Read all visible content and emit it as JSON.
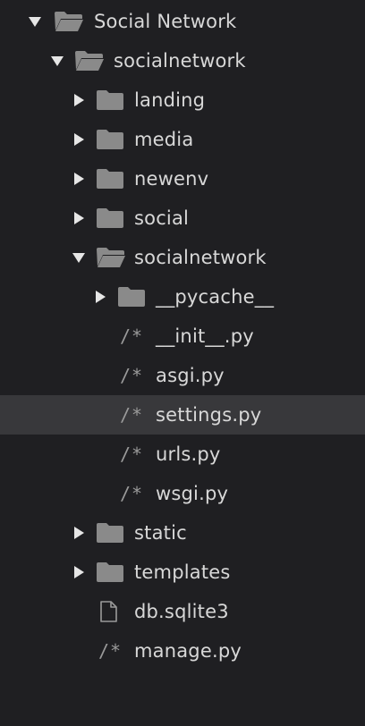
{
  "tree": {
    "root": {
      "label": "Social Network",
      "icon": "folder-open-icon"
    },
    "project": {
      "label": "socialnetwork",
      "icon": "folder-open-icon"
    },
    "children": [
      {
        "label": "landing",
        "icon": "folder-icon"
      },
      {
        "label": "media",
        "icon": "folder-icon"
      },
      {
        "label": "newenv",
        "icon": "folder-icon"
      },
      {
        "label": "social",
        "icon": "folder-icon"
      }
    ],
    "app": {
      "label": "socialnetwork",
      "icon": "folder-open-icon"
    },
    "app_children": [
      {
        "label": "__pycache__",
        "icon": "folder-icon"
      },
      {
        "label": "__init__.py",
        "icon": "python-file-icon",
        "glyph": "/*"
      },
      {
        "label": "asgi.py",
        "icon": "python-file-icon",
        "glyph": "/*"
      },
      {
        "label": "settings.py",
        "icon": "python-file-icon",
        "glyph": "/*",
        "selected": true
      },
      {
        "label": "urls.py",
        "icon": "python-file-icon",
        "glyph": "/*"
      },
      {
        "label": "wsgi.py",
        "icon": "python-file-icon",
        "glyph": "/*"
      }
    ],
    "tail": [
      {
        "label": "static",
        "icon": "folder-icon"
      },
      {
        "label": "templates",
        "icon": "folder-icon"
      },
      {
        "label": "db.sqlite3",
        "icon": "file-icon"
      },
      {
        "label": "manage.py",
        "icon": "python-file-icon",
        "glyph": "/*"
      }
    ]
  },
  "colors": {
    "background": "#1f1f22",
    "selection": "#38383b",
    "folder": "#8a8a8a",
    "text": "#d8d8d8"
  }
}
